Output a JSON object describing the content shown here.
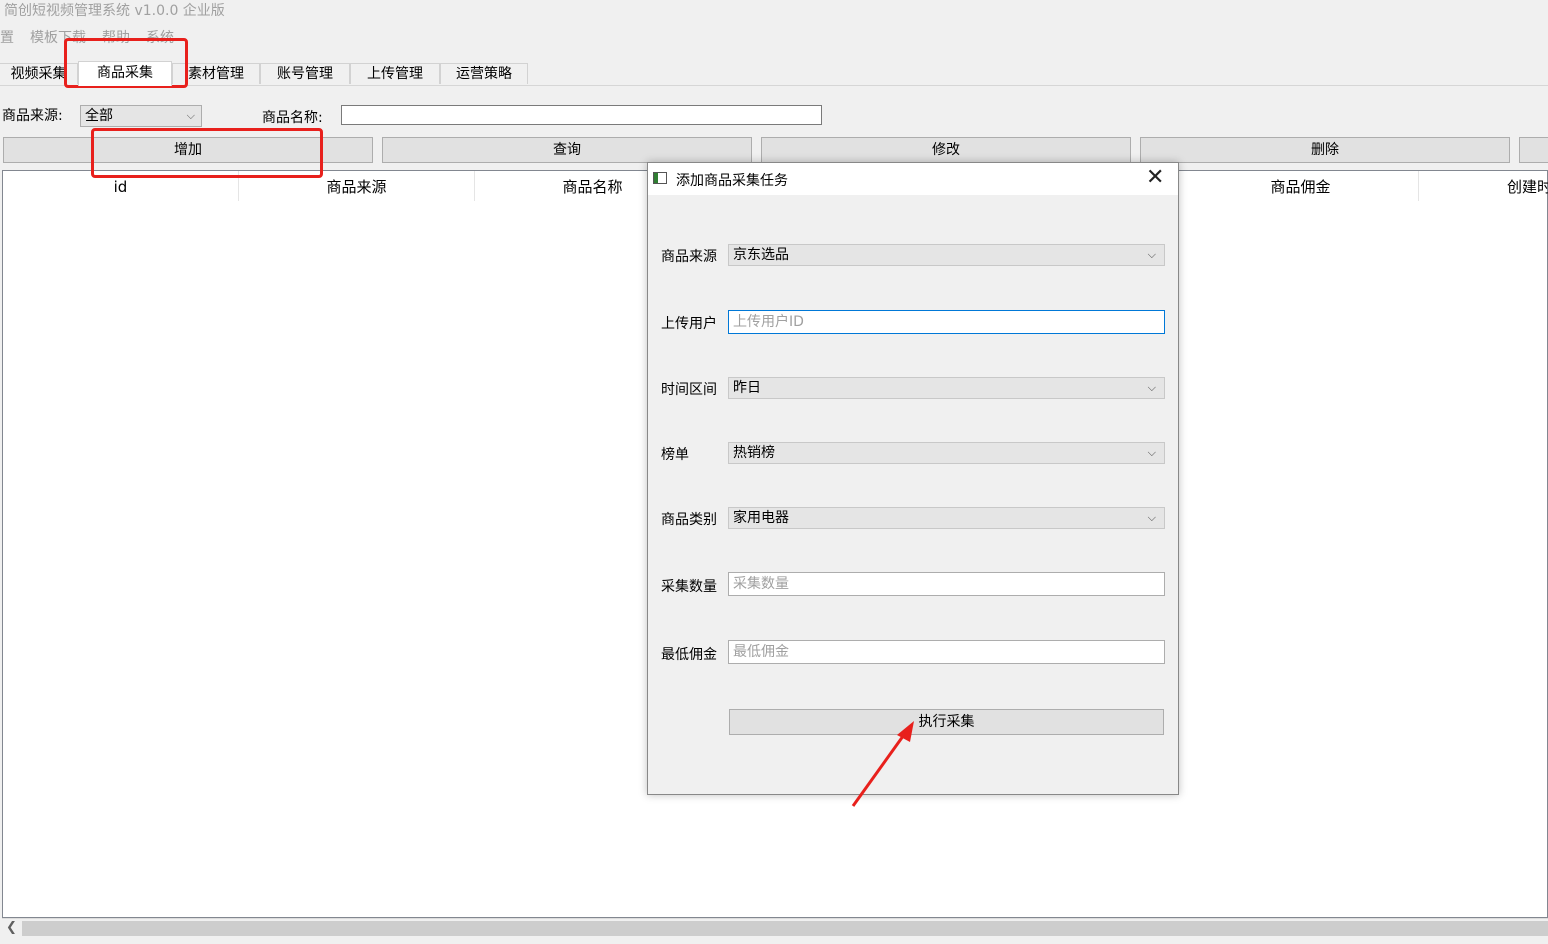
{
  "window": {
    "title": "简创短视频管理系统 v1.0.0 企业版"
  },
  "menu": {
    "items": [
      "置",
      "模板下载",
      "帮助",
      "系统"
    ]
  },
  "tabs": [
    "视频采集",
    "商品采集",
    "素材管理",
    "账号管理",
    "上传管理",
    "运营策略"
  ],
  "active_tab": "商品采集",
  "filter": {
    "source_label": "商品来源:",
    "source_value": "全部",
    "name_label": "商品名称:",
    "name_value": ""
  },
  "toolbar": {
    "add": "增加",
    "query": "查询",
    "edit": "修改",
    "delete": "删除"
  },
  "table": {
    "columns": [
      "id",
      "商品来源",
      "商品名称",
      "商品佣金",
      "创建时"
    ]
  },
  "dialog": {
    "title": "添加商品采集任务",
    "fields": {
      "source": {
        "label": "商品来源",
        "value": "京东选品"
      },
      "uploader": {
        "label": "上传用户",
        "placeholder": "上传用户ID"
      },
      "time_range": {
        "label": "时间区间",
        "value": "昨日"
      },
      "ranking": {
        "label": "榜单",
        "value": "热销榜"
      },
      "category": {
        "label": "商品类别",
        "value": "家用电器"
      },
      "count": {
        "label": "采集数量",
        "placeholder": "采集数量"
      },
      "min_commission": {
        "label": "最低佣金",
        "placeholder": "最低佣金"
      }
    },
    "submit": "执行采集"
  },
  "annotation_color": "#e8201c",
  "icons": [
    "chevron-down-icon",
    "close-icon",
    "window-icon",
    "chevron-left-icon",
    "arrow-annotation"
  ]
}
